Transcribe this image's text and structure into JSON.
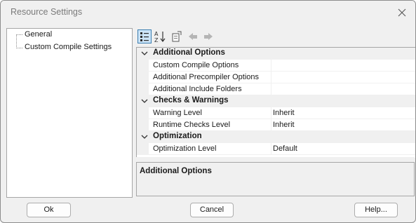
{
  "window": {
    "title": "Resource Settings"
  },
  "tree": {
    "items": [
      {
        "label": "General"
      },
      {
        "label": "Custom Compile Settings"
      }
    ]
  },
  "toolbar": {
    "buttons": [
      {
        "icon": "categorized-icon",
        "active": true
      },
      {
        "icon": "sort-alphabetical-icon",
        "active": false
      },
      {
        "icon": "property-pages-icon",
        "active": false
      },
      {
        "icon": "back-icon",
        "active": false
      },
      {
        "icon": "forward-icon",
        "active": false
      }
    ]
  },
  "grid": {
    "categories": [
      {
        "label": "Additional Options",
        "properties": [
          {
            "name": "Custom Compile Options",
            "value": ""
          },
          {
            "name": "Additional Precompiler Options",
            "value": ""
          },
          {
            "name": "Additional Include Folders",
            "value": ""
          }
        ]
      },
      {
        "label": "Checks & Warnings",
        "properties": [
          {
            "name": "Warning Level",
            "value": "Inherit"
          },
          {
            "name": "Runtime Checks Level",
            "value": "Inherit"
          }
        ]
      },
      {
        "label": "Optimization",
        "properties": [
          {
            "name": "Optimization Level",
            "value": "Default"
          }
        ]
      }
    ]
  },
  "description": {
    "title": "Additional Options"
  },
  "buttons": {
    "ok": "Ok",
    "cancel": "Cancel",
    "help": "Help..."
  }
}
